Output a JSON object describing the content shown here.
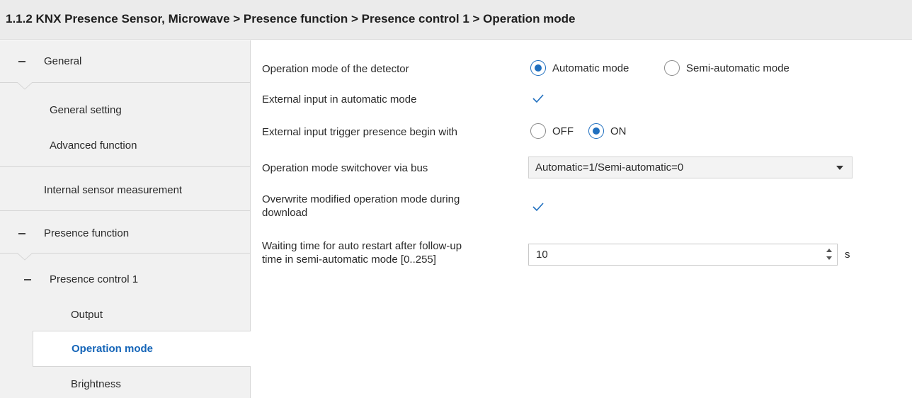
{
  "header": {
    "title": "1.1.2 KNX Presence Sensor, Microwave > Presence function > Presence control 1 > Operation mode"
  },
  "sidebar": {
    "general": "General",
    "general_setting": "General setting",
    "advanced_function": "Advanced function",
    "internal_sensor_measurement": "Internal sensor measurement",
    "presence_function": "Presence function",
    "presence_control_1": "Presence control 1",
    "output": "Output",
    "operation_mode": "Operation mode",
    "brightness": "Brightness"
  },
  "form": {
    "operation_mode": {
      "label": "Operation mode of the detector",
      "options": [
        "Automatic mode",
        "Semi-automatic mode"
      ],
      "selected": "Automatic mode"
    },
    "external_input": {
      "label": "External input in automatic mode",
      "checked": true
    },
    "trigger_presence": {
      "label": "External input trigger presence begin with",
      "options": [
        "OFF",
        "ON"
      ],
      "selected": "ON"
    },
    "switchover": {
      "label": "Operation mode switchover via bus",
      "value": "Automatic=1/Semi-automatic=0"
    },
    "overwrite": {
      "label_line1": "Overwrite modified operation mode during",
      "label_line2": "download",
      "checked": true
    },
    "waiting_time": {
      "label_line1": "Waiting time for auto restart after follow-up",
      "label_line2": "time in semi-automatic mode [0..255]",
      "value": "10",
      "unit": "s"
    }
  },
  "colors": {
    "accent": "#1f6fbf",
    "active_nav_text": "#1565b8",
    "sidebar_bg": "#f1f1f1",
    "titlebar_bg": "#ebebeb"
  }
}
